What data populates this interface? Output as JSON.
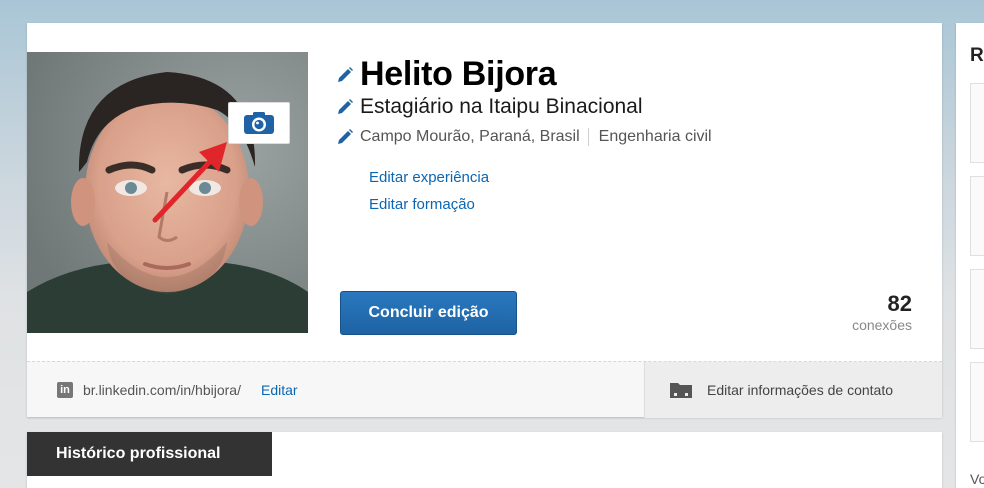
{
  "profile": {
    "name": "Helito Bijora",
    "headline": "Estagiário na Itaipu Binacional",
    "location": "Campo Mourão, Paraná, Brasil",
    "industry": "Engenharia civil",
    "links": {
      "edit_experience": "Editar experiência",
      "edit_education": "Editar formação"
    },
    "finish_button": "Concluir edição",
    "connections": {
      "count": "82",
      "label": "conexões"
    },
    "photo": {
      "camera_icon": "camera-icon",
      "annotation_arrow_color": "#e0262a"
    }
  },
  "footer": {
    "linkedin_icon": "linkedin-icon",
    "public_url": "br.linkedin.com/in/hbijora/",
    "edit_label": "Editar",
    "contact_icon": "folder-icon",
    "contact_label": "Editar informações de contato"
  },
  "sections": {
    "tab_label": "Histórico profissional"
  },
  "right_column": {
    "title_fragment": "R",
    "footer_fragment": "Vo"
  },
  "colors": {
    "link": "#0b66b2",
    "primary_button": "#1e63a4",
    "header_band": "#a9c6d6",
    "tab_bg": "#333333"
  }
}
